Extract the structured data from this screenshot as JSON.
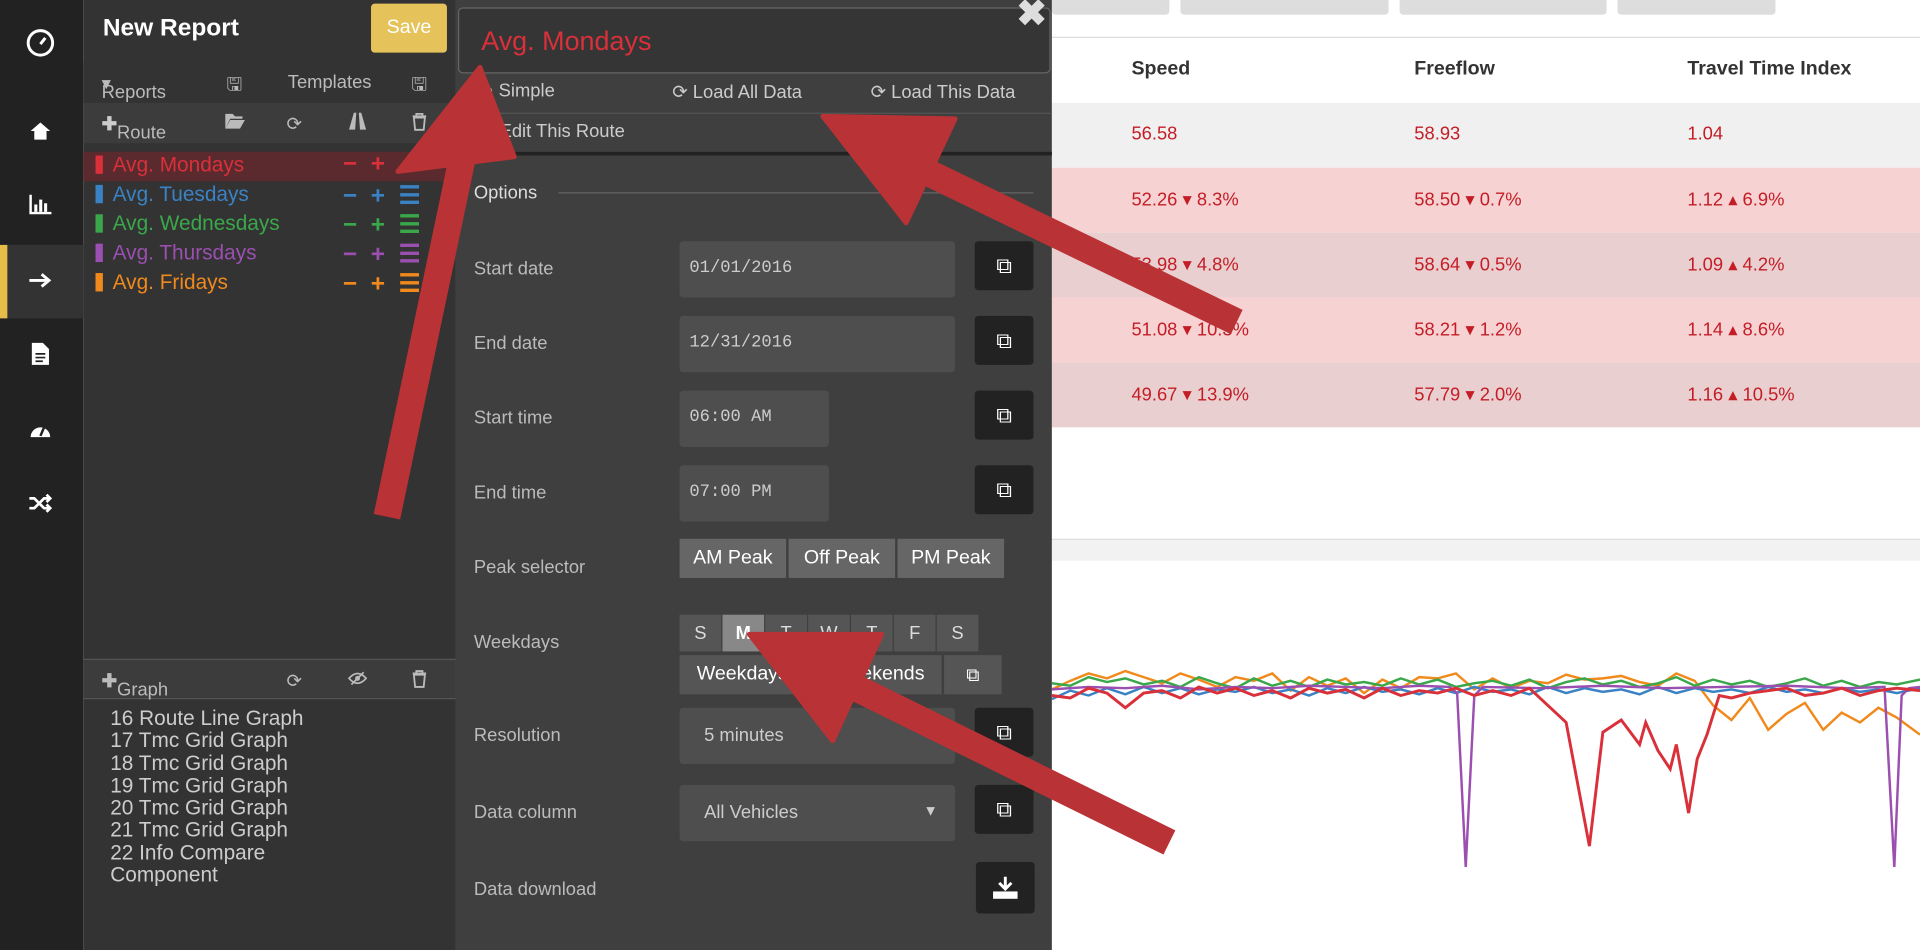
{
  "report": {
    "title": "New Report",
    "save_label": "Save"
  },
  "toolbar": {
    "reports_label": "Reports",
    "templates_label": "Templates",
    "route_label": "Route",
    "graph_label": "Graph"
  },
  "routes": [
    {
      "name": "Avg. Mondays",
      "color": "#d9303a"
    },
    {
      "name": "Avg. Tuesdays",
      "color": "#3b82c4"
    },
    {
      "name": "Avg. Wednesdays",
      "color": "#3aa84a"
    },
    {
      "name": "Avg. Thursdays",
      "color": "#9b4fb0"
    },
    {
      "name": "Avg. Fridays",
      "color": "#f08a1c"
    }
  ],
  "graphs": [
    "16 Route Line Graph",
    "17 Tmc Grid Graph",
    "18 Tmc Grid Graph",
    "19 Tmc Grid Graph",
    "20 Tmc Grid Graph",
    "21 Tmc Grid Graph",
    "22 Info Compare Component"
  ],
  "editor": {
    "route_name": "Avg. Mondays",
    "tab_simple": "Simple",
    "load_all": "Load All Data",
    "load_this": "Load This Data",
    "edit_route": "Edit This Route",
    "options_title": "Options",
    "start_date_label": "Start date",
    "start_date": "01/01/2016",
    "end_date_label": "End date",
    "end_date": "12/31/2016",
    "start_time_label": "Start time",
    "start_time": "06:00 AM",
    "end_time_label": "End time",
    "end_time": "07:00 PM",
    "peak_label": "Peak selector",
    "peaks": [
      "AM Peak",
      "Off Peak",
      "PM Peak"
    ],
    "weekdays_label": "Weekdays",
    "days": [
      "S",
      "M",
      "T",
      "W",
      "T",
      "F",
      "S"
    ],
    "selected_day": "M",
    "weekdays_btn": "Weekdays",
    "weekends_btn": "Weekends",
    "resolution_label": "Resolution",
    "resolution": "5 minutes",
    "data_column_label": "Data column",
    "data_column": "All Vehicles",
    "download_label": "Data download"
  },
  "table": {
    "headers": [
      "Speed",
      "Freeflow",
      "Travel Time Index"
    ],
    "rows": [
      {
        "speed": "56.58",
        "speed_delta": "",
        "freeflow": "58.93",
        "freeflow_delta": "",
        "tti": "1.04",
        "tti_delta": ""
      },
      {
        "speed": "52.26",
        "speed_delta": "8.3%",
        "freeflow": "58.50",
        "freeflow_delta": "0.7%",
        "tti": "1.12",
        "tti_delta": "6.9%"
      },
      {
        "speed": "53.98",
        "speed_delta": "4.8%",
        "freeflow": "58.64",
        "freeflow_delta": "0.5%",
        "tti": "1.09",
        "tti_delta": "4.2%"
      },
      {
        "speed": "51.08",
        "speed_delta": "10.3%",
        "freeflow": "58.21",
        "freeflow_delta": "1.2%",
        "tti": "1.14",
        "tti_delta": "8.6%"
      },
      {
        "speed": "49.67",
        "speed_delta": "13.9%",
        "freeflow": "57.79",
        "freeflow_delta": "2.0%",
        "tti": "1.16",
        "tti_delta": "10.5%"
      }
    ]
  },
  "colors": {
    "accent": "#e6bd48",
    "arrow": "#b93235",
    "negative": "#c41d26"
  }
}
